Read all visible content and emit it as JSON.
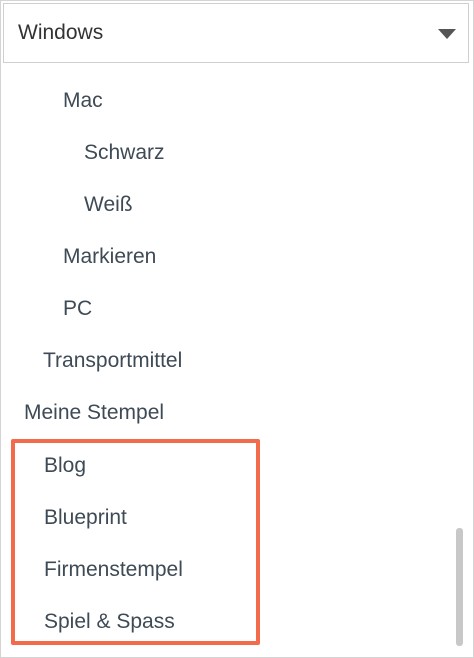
{
  "dropdown": {
    "selected": "Windows",
    "icon": "chevron-down-icon"
  },
  "list": {
    "items": [
      {
        "label": "Mac"
      },
      {
        "label": "Schwarz"
      },
      {
        "label": "Weiß"
      },
      {
        "label": "Markieren"
      },
      {
        "label": "PC"
      },
      {
        "label": "Transportmittel"
      },
      {
        "label": "Meine Stempel"
      },
      {
        "label": "Blog"
      },
      {
        "label": "Blueprint"
      },
      {
        "label": "Firmenstempel"
      },
      {
        "label": "Spiel & Spass"
      }
    ]
  },
  "highlight_color": "#f26b4b"
}
